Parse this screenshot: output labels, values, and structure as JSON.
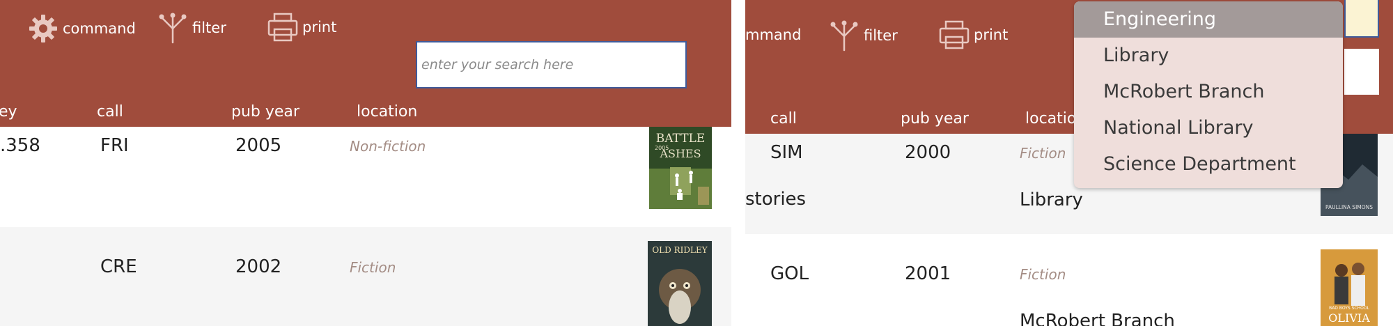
{
  "toolbar": {
    "command_label": "command",
    "command_label_cropped": "mmand",
    "filter_label": "filter",
    "print_label": "print",
    "search_placeholder": "enter your search here"
  },
  "columns": {
    "key_cropped": "ey",
    "call": "call",
    "pub_year": "pub year",
    "location": "location",
    "location_cropped": "locatio"
  },
  "left_rows": [
    {
      "key": ".358",
      "call": "FRI",
      "pub_year": "2005",
      "genre": "Non-fiction",
      "cover": "Battle for the Ashes cover"
    },
    {
      "key": "",
      "call": "CRE",
      "pub_year": "2002",
      "genre": "Fiction",
      "cover": "Old Ridley cover"
    }
  ],
  "right_rows": [
    {
      "title_cropped": "stories",
      "call": "SIM",
      "pub_year": "2000",
      "genre": "Fiction",
      "location": "Library",
      "cover": "Paullina Simons cover"
    },
    {
      "call": "GOL",
      "pub_year": "2001",
      "genre": "Fiction",
      "location": "McRobert Branch",
      "cover": "Olivia Bad Boys School cover"
    }
  ],
  "cover_text": {
    "battle": "BATTLE",
    "ashes": "ASHES",
    "year": "2005",
    "old_ridley": "OLD RIDLEY",
    "paullina": "PAULLINA SIMONS",
    "olivia": "OLIVIA",
    "bad_boys": "BAD BOYS SCHOOL"
  },
  "location_dropdown": {
    "options": [
      "Engineering",
      "Library",
      "McRobert Branch",
      "National Library",
      "Science Department"
    ],
    "selected": "Engineering"
  },
  "colors": {
    "toolbar": "#a04c3c",
    "row_alt": "#f5f5f5",
    "genre_text": "#a38c84",
    "search_border": "#3f5a9a",
    "dropdown_bg": "#efdedb",
    "dropdown_selected": "#a39a99"
  }
}
